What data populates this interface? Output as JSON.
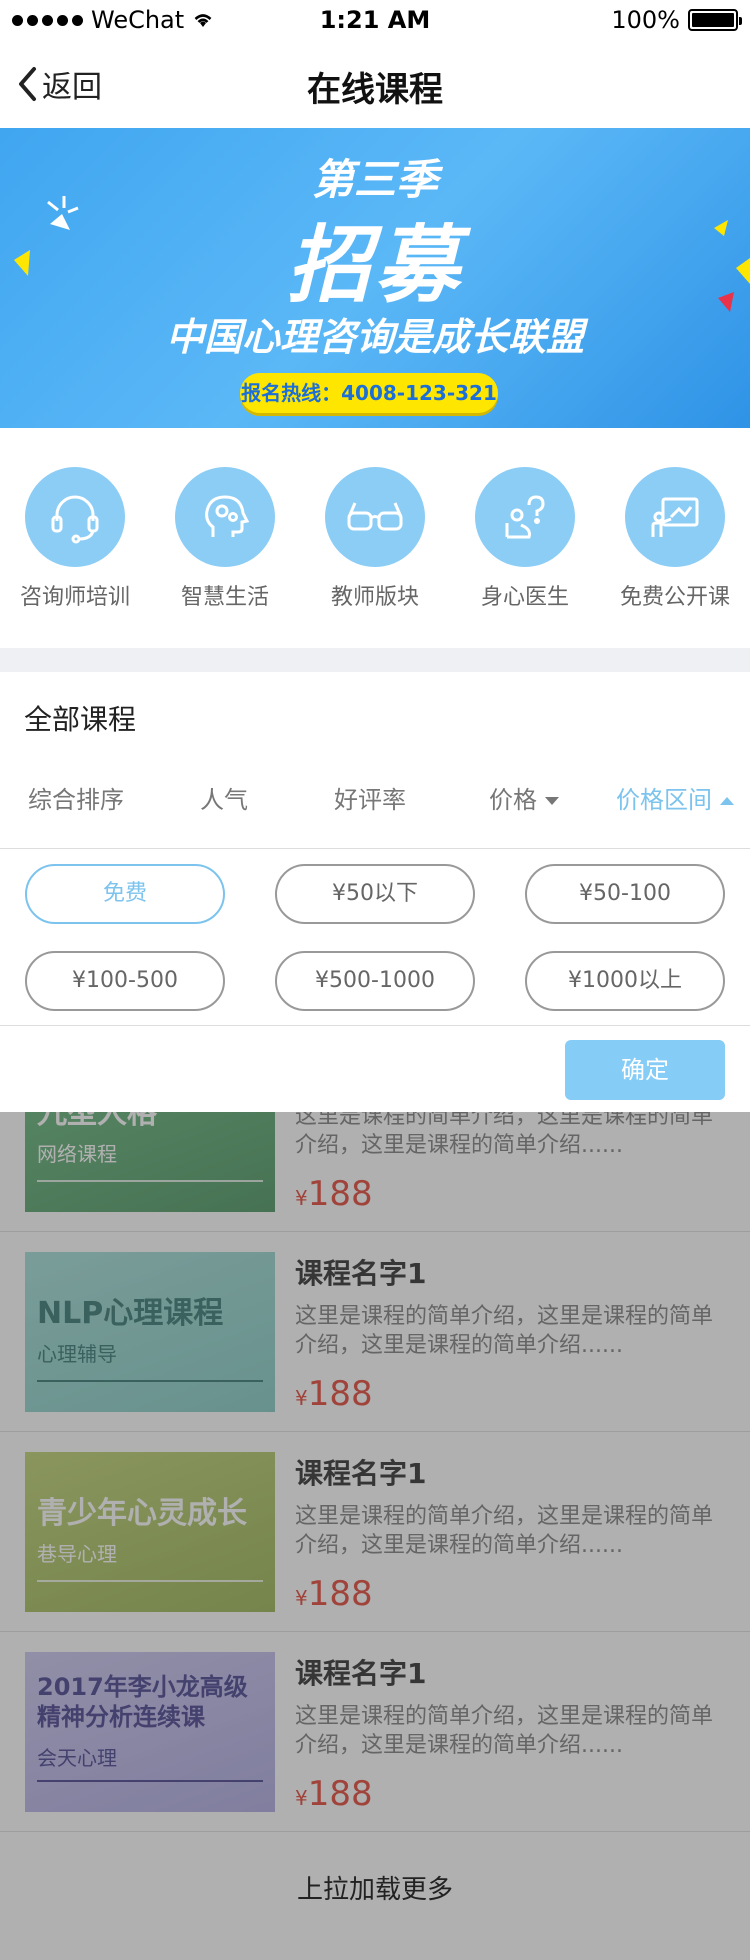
{
  "status_bar": {
    "carrier": "WeChat",
    "time": "1:21 AM",
    "battery": "100%"
  },
  "nav": {
    "back_label": "返回",
    "title": "在线课程"
  },
  "banner": {
    "line1": "第三季",
    "line2": "招募",
    "line3": "中国心理咨询是成长联盟",
    "hotline": "报名热线：4008-123-321"
  },
  "categories": [
    {
      "label": "咨询师培训",
      "icon": "headset-icon"
    },
    {
      "label": "智慧生活",
      "icon": "brain-gear-icon"
    },
    {
      "label": "教师版块",
      "icon": "glasses-icon"
    },
    {
      "label": "身心医生",
      "icon": "question-person-icon"
    },
    {
      "label": "免费公开课",
      "icon": "teacher-board-icon"
    }
  ],
  "section_title": "全部课程",
  "sort_options": [
    {
      "label": "综合排序"
    },
    {
      "label": "人气"
    },
    {
      "label": "好评率"
    },
    {
      "label": "价格"
    },
    {
      "label": "价格区间"
    }
  ],
  "price_filters": [
    "免费",
    "¥50以下",
    "¥50-100",
    "¥100-500",
    "¥500-1000",
    "¥1000以上"
  ],
  "selected_filter": "免费",
  "confirm_label": "确定",
  "courses": [
    {
      "thumb_title": "九型人格",
      "thumb_sub": "网络课程",
      "name": "",
      "desc": "这里是课程的简单介绍，这里是课程的简单介绍，这里是课程的简单介绍......",
      "currency": "¥",
      "price": "188",
      "thumb_color": "#5aa86a"
    },
    {
      "thumb_title": "NLP心理课程",
      "thumb_sub": "心理辅导",
      "name": "课程名字1",
      "desc": "这里是课程的简单介绍，这里是课程的简单介绍，这里是课程的简单介绍......",
      "currency": "¥",
      "price": "188",
      "thumb_color": "#8ed2cc"
    },
    {
      "thumb_title": "青少年心灵成长",
      "thumb_sub": "巷导心理",
      "name": "课程名字1",
      "desc": "这里是课程的简单介绍，这里是课程的简单介绍，这里是课程的简单介绍......",
      "currency": "¥",
      "price": "188",
      "thumb_color": "#a9c35a"
    },
    {
      "thumb_title": "2017年李小龙高级精神分析连续课",
      "thumb_sub": "会天心理",
      "name": "课程名字1",
      "desc": "这里是课程的简单介绍，这里是课程的简单介绍，这里是课程的简单介绍......",
      "currency": "¥",
      "price": "188",
      "thumb_color": "#b7b3e6"
    }
  ],
  "load_more": "上拉加载更多",
  "colors": {
    "accent": "#7cc3ee",
    "price": "#e23a2a",
    "banner": "#40a6f0"
  }
}
